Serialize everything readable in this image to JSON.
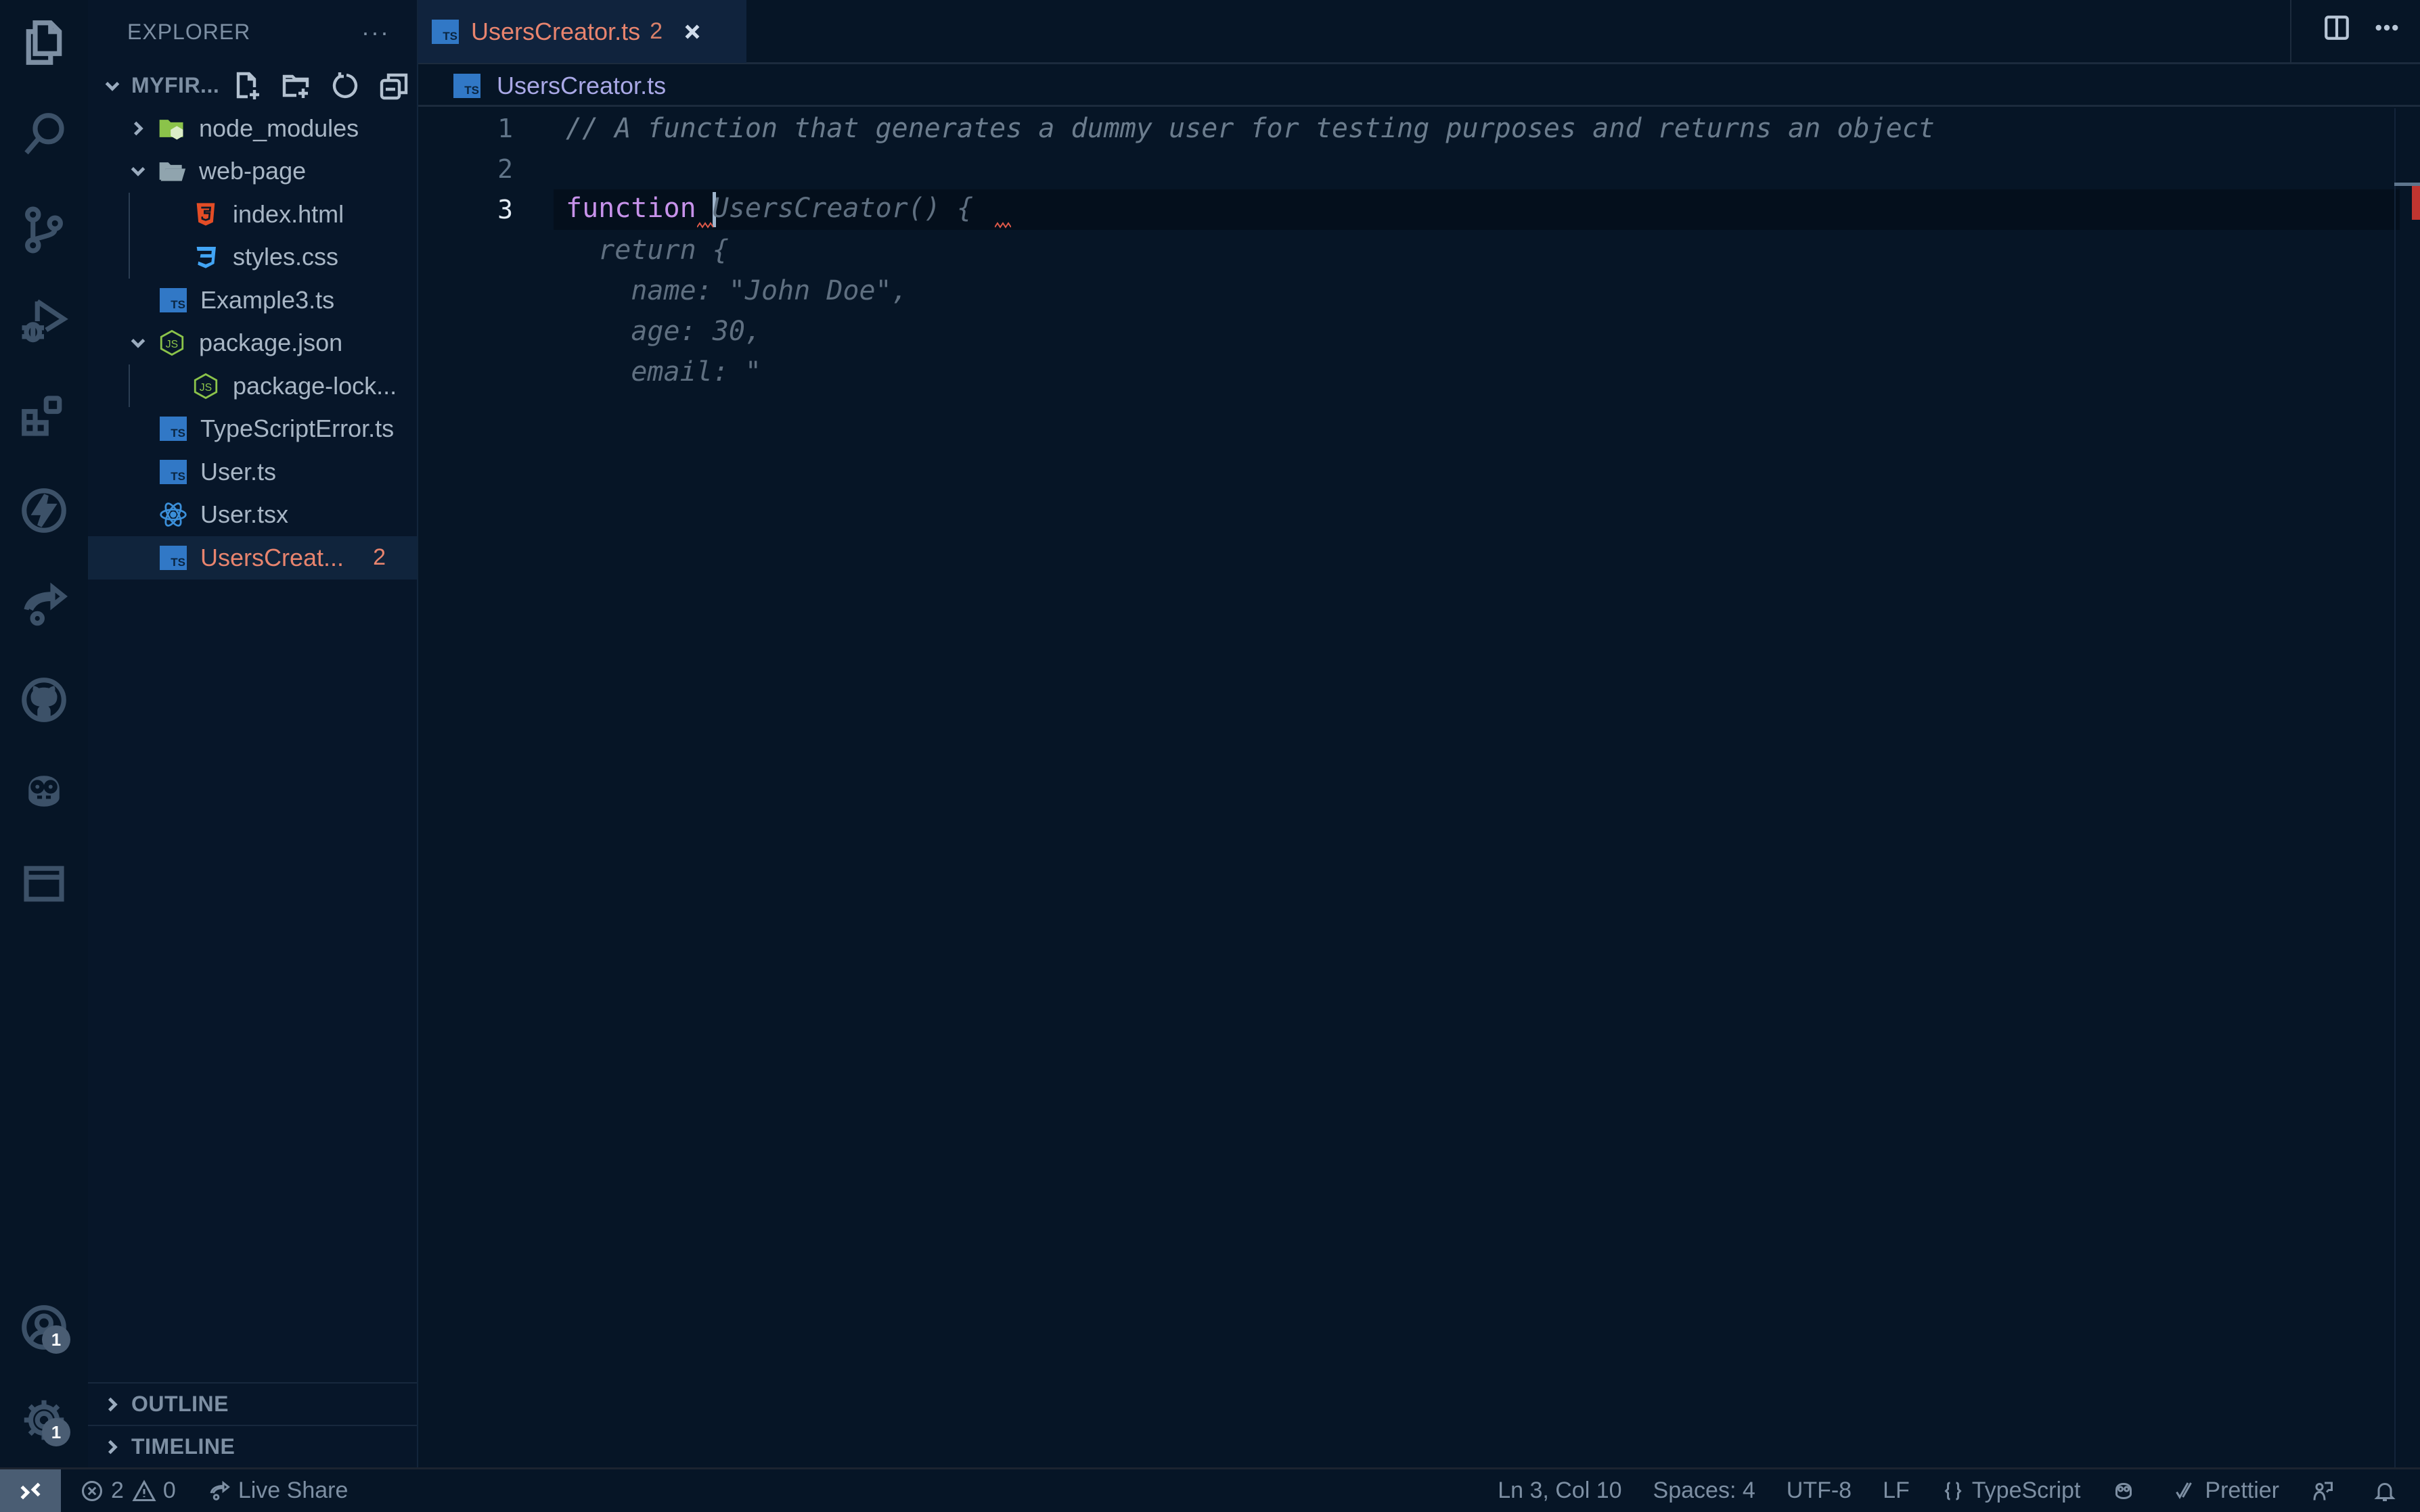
{
  "activity_bar": {
    "items": [
      {
        "name": "explorer",
        "icon": "files-icon",
        "active": true
      },
      {
        "name": "search",
        "icon": "search-icon"
      },
      {
        "name": "source-control",
        "icon": "source-control-icon"
      },
      {
        "name": "run-debug",
        "icon": "run-debug-icon"
      },
      {
        "name": "extensions",
        "icon": "extensions-icon"
      },
      {
        "name": "thunder",
        "icon": "lightning-icon"
      },
      {
        "name": "live-share",
        "icon": "live-share-icon"
      },
      {
        "name": "github",
        "icon": "github-icon"
      },
      {
        "name": "copilot",
        "icon": "copilot-icon"
      },
      {
        "name": "panel",
        "icon": "window-icon"
      }
    ],
    "accounts_badge": "1",
    "settings_badge": "1"
  },
  "sidebar": {
    "title": "EXPLORER",
    "more": "···",
    "workspace": "MYFIR...",
    "tree": [
      {
        "label": "node_modules",
        "type": "folder-node",
        "depth": 1,
        "expanded": false
      },
      {
        "label": "web-page",
        "type": "folder",
        "depth": 1,
        "expanded": true
      },
      {
        "label": "index.html",
        "type": "html",
        "depth": 2
      },
      {
        "label": "styles.css",
        "type": "css",
        "depth": 2
      },
      {
        "label": "Example3.ts",
        "type": "ts",
        "depth": 1
      },
      {
        "label": "package.json",
        "type": "json-node",
        "depth": 1,
        "expanded": true
      },
      {
        "label": "package-lock...",
        "type": "json-node",
        "depth": 2
      },
      {
        "label": "TypeScriptError.ts",
        "type": "ts",
        "depth": 1
      },
      {
        "label": "User.ts",
        "type": "ts",
        "depth": 1
      },
      {
        "label": "User.tsx",
        "type": "react",
        "depth": 1
      },
      {
        "label": "UsersCreat...",
        "type": "ts",
        "depth": 1,
        "selected": true,
        "errors": "2"
      }
    ],
    "outline": "OUTLINE",
    "timeline": "TIMELINE"
  },
  "tabs": [
    {
      "label": "UsersCreator.ts",
      "problems": "2",
      "active": true
    }
  ],
  "breadcrumb": {
    "file": "UsersCreator.ts"
  },
  "editor": {
    "lines": [
      {
        "num": "1",
        "text": "// A function that generates a dummy user for testing purposes and returns an object"
      },
      {
        "num": "2",
        "text": ""
      },
      {
        "num": "3",
        "keyword": "function",
        "ghost": "UsersCreator() {"
      }
    ],
    "ghost_lines": [
      "  return {",
      "    name: \"John Doe\",",
      "    age: 30,",
      "    email: \""
    ]
  },
  "statusbar": {
    "errors": "2",
    "warnings": "0",
    "live_share": "Live Share",
    "position": "Ln 3, Col 10",
    "spaces": "Spaces: 4",
    "encoding": "UTF-8",
    "eol": "LF",
    "language": "TypeScript",
    "formatter": "Prettier"
  },
  "colors": {
    "error": "#e8846e",
    "keyword": "#c792ea",
    "breadcrumb": "#a9a8e6",
    "ts_blue": "#3178c6"
  }
}
